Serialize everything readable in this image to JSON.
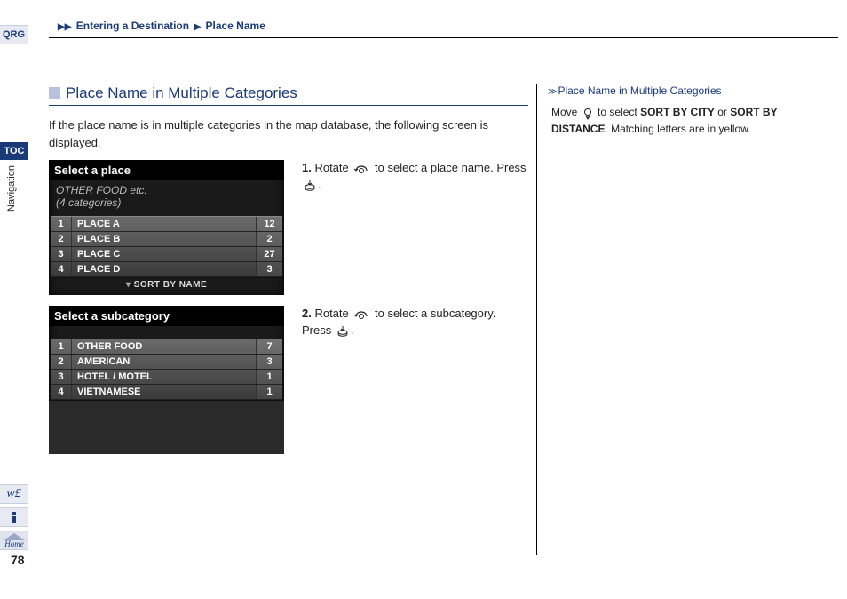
{
  "breadcrumb": {
    "level1": "Entering a Destination",
    "level2": "Place Name"
  },
  "tabs": {
    "qrg": "QRG",
    "toc": "TOC",
    "nav": "Navigation",
    "voice": "w£",
    "info": "i",
    "home": "Home"
  },
  "page_number": "78",
  "section": {
    "title": "Place Name in Multiple Categories",
    "intro": "If the place name is in multiple categories in the map database, the following screen is displayed."
  },
  "steps": [
    {
      "number": "1.",
      "text_a": "Rotate",
      "text_b": "to select a place name. Press",
      "text_c": "."
    },
    {
      "number": "2.",
      "text_a": "Rotate",
      "text_b": "to select a subcategory. Press",
      "text_c": "."
    }
  ],
  "screenshot1": {
    "title": "Select a place",
    "subtitle_line1": "OTHER FOOD etc.",
    "subtitle_line2": "(4 categories)",
    "rows": [
      {
        "idx": "1",
        "label": "PLACE A",
        "count": "12"
      },
      {
        "idx": "2",
        "label": "PLACE B",
        "count": "2"
      },
      {
        "idx": "3",
        "label": "PLACE C",
        "count": "27"
      },
      {
        "idx": "4",
        "label": "PLACE D",
        "count": "3"
      }
    ],
    "footer": "SORT BY NAME"
  },
  "screenshot2": {
    "title": "Select a subcategory",
    "rows": [
      {
        "idx": "1",
        "label": "OTHER FOOD",
        "count": "7"
      },
      {
        "idx": "2",
        "label": "AMERICAN",
        "count": "3"
      },
      {
        "idx": "3",
        "label": "HOTEL / MOTEL",
        "count": "1"
      },
      {
        "idx": "4",
        "label": "VIETNAMESE",
        "count": "1"
      }
    ]
  },
  "sidebar": {
    "heading": "Place Name in Multiple Categories",
    "move": "Move",
    "text_a": "to select",
    "sort_city": "SORT BY CITY",
    "or": "or",
    "sort_dist": "SORT BY DISTANCE",
    "tail": ". Matching letters are in yellow."
  }
}
